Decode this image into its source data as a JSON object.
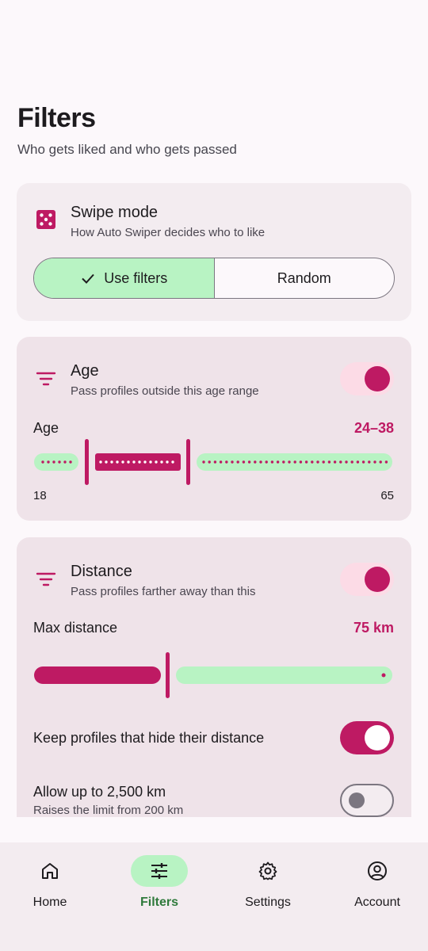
{
  "header": {
    "title": "Filters",
    "subtitle": "Who gets liked and who gets passed"
  },
  "swipe_mode": {
    "icon": "dice-icon",
    "title": "Swipe mode",
    "subtitle": "How Auto Swiper decides who to like",
    "options": [
      "Use filters",
      "Random"
    ],
    "selected": "Use filters"
  },
  "age": {
    "icon": "filter-icon",
    "title": "Age",
    "subtitle": "Pass profiles outside this age range",
    "enabled": true,
    "label": "Age",
    "value_text": "24–38",
    "min_label": "18",
    "max_label": "65",
    "range_min": 18,
    "range_max": 65,
    "selected_low": 24,
    "selected_high": 38
  },
  "distance": {
    "icon": "filter-icon",
    "title": "Distance",
    "subtitle": "Pass profiles farther away than this",
    "enabled": true,
    "label": "Max distance",
    "value_text": "75 km",
    "range_max": 200,
    "value": 75,
    "keep_hidden_label": "Keep profiles that hide their distance",
    "keep_hidden_on": true,
    "extended_label": "Allow up to 2,500 km",
    "extended_sub": "Raises the limit from 200 km",
    "extended_on": false
  },
  "nav": {
    "items": [
      {
        "label": "Home",
        "icon": "home-icon"
      },
      {
        "label": "Filters",
        "icon": "sliders-icon"
      },
      {
        "label": "Settings",
        "icon": "gear-icon"
      },
      {
        "label": "Account",
        "icon": "account-icon"
      }
    ],
    "active": "Filters"
  },
  "colors": {
    "accent": "#be1a63",
    "active_container": "#b8f3c3",
    "card": "#f3ecf0",
    "background": "#fcf8fb"
  }
}
